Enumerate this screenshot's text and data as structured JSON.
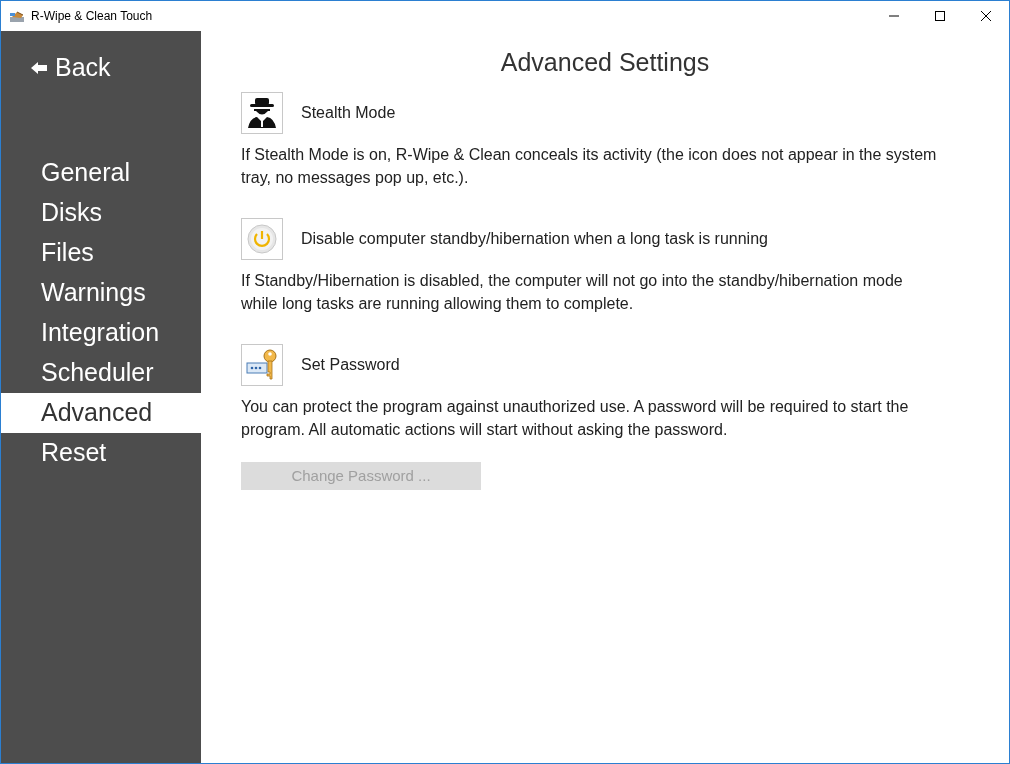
{
  "window": {
    "title": "R-Wipe & Clean Touch"
  },
  "sidebar": {
    "back": "Back",
    "items": [
      {
        "label": "General",
        "selected": false
      },
      {
        "label": "Disks",
        "selected": false
      },
      {
        "label": "Files",
        "selected": false
      },
      {
        "label": "Warnings",
        "selected": false
      },
      {
        "label": "Integration",
        "selected": false
      },
      {
        "label": "Scheduler",
        "selected": false
      },
      {
        "label": "Advanced",
        "selected": true
      },
      {
        "label": "Reset",
        "selected": false
      }
    ]
  },
  "heading": "Advanced Settings",
  "settings": [
    {
      "kind": "stealth",
      "title": "Stealth Mode",
      "description": "If Stealth Mode is on, R-Wipe & Clean conceals its activity (the icon does not appear in the system tray, no messages pop up, etc.)."
    },
    {
      "kind": "power",
      "title": "Disable computer standby/hibernation when a long task is running",
      "description": "If Standby/Hibernation is disabled, the computer will not go into the standby/hibernation mode while long tasks are running allowing them to complete."
    },
    {
      "kind": "password",
      "title": "Set Password",
      "description": "You can protect the program against unauthorized use. A password will be required to start the program. All automatic actions will start without asking the password."
    }
  ],
  "change_password_button": {
    "label": "Change Password ...",
    "disabled": true
  }
}
